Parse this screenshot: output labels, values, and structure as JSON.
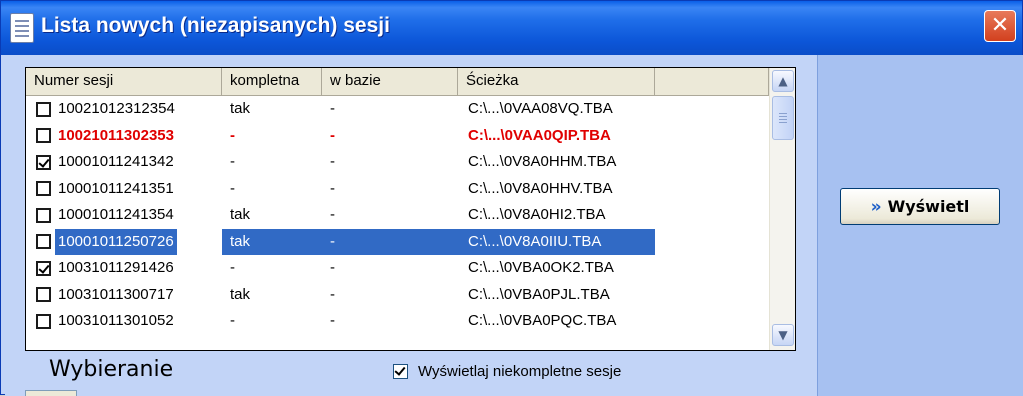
{
  "window": {
    "title": "Lista nowych (niezapisanych) sesji",
    "close_glyph": "✕"
  },
  "table": {
    "headers": [
      "Numer sesji",
      "kompletna",
      "w bazie",
      "Ścieżka"
    ],
    "rows": [
      {
        "checked": false,
        "session": "10021012312354",
        "complete": "tak",
        "in_db": "-",
        "path": "C:\\...\\0VAA08VQ.TBA",
        "style": "normal"
      },
      {
        "checked": false,
        "session": "10021011302353",
        "complete": "-",
        "in_db": "-",
        "path": "C:\\...\\0VAA0QIP.TBA",
        "style": "red"
      },
      {
        "checked": true,
        "session": "10001011241342",
        "complete": "-",
        "in_db": "-",
        "path": "C:\\...\\0V8A0HHM.TBA",
        "style": "normal"
      },
      {
        "checked": false,
        "session": "10001011241351",
        "complete": "-",
        "in_db": "-",
        "path": "C:\\...\\0V8A0HHV.TBA",
        "style": "normal"
      },
      {
        "checked": false,
        "session": "10001011241354",
        "complete": "tak",
        "in_db": "-",
        "path": "C:\\...\\0V8A0HI2.TBA",
        "style": "normal"
      },
      {
        "checked": false,
        "session": "10001011250726",
        "complete": "tak",
        "in_db": "-",
        "path": "C:\\...\\0V8A0IIU.TBA",
        "style": "selected"
      },
      {
        "checked": true,
        "session": "10031011291426",
        "complete": "-",
        "in_db": "-",
        "path": "C:\\...\\0VBA0OK2.TBA",
        "style": "normal"
      },
      {
        "checked": false,
        "session": "10031011300717",
        "complete": "tak",
        "in_db": "-",
        "path": "C:\\...\\0VBA0PJL.TBA",
        "style": "normal"
      },
      {
        "checked": false,
        "session": "10031011301052",
        "complete": "-",
        "in_db": "-",
        "path": "C:\\...\\0VBA0PQC.TBA",
        "style": "normal"
      }
    ]
  },
  "scrollbar": {
    "up_glyph": "▲",
    "down_glyph": "▼"
  },
  "bottom": {
    "selecting_label": "Wybieranie",
    "show_incomplete_label": "Wyświetlaj niekompletne sesje",
    "show_incomplete_checked": true
  },
  "actions": {
    "show_label": "Wyświetl",
    "show_arrows": "»"
  },
  "colors": {
    "selection": "#316ac5",
    "incomplete_row": "#e00000",
    "titlebar": "#0c56d8",
    "close": "#d2401e"
  }
}
